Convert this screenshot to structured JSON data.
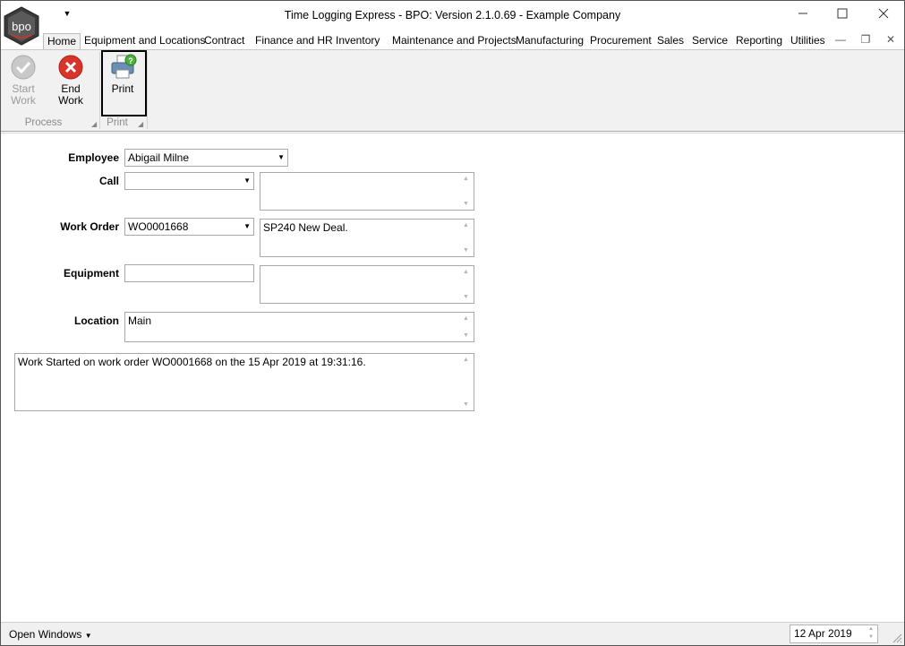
{
  "window": {
    "title": "Time Logging Express - BPO: Version 2.1.0.69 - Example Company",
    "logo_text": "bpo",
    "qat_icon": "chevron-down-icon",
    "minimize_icon": "minimize-icon",
    "maximize_icon": "maximize-icon",
    "close_icon": "close-icon"
  },
  "tabs": [
    {
      "label": "Home",
      "active": true
    },
    {
      "label": "Equipment and Locations"
    },
    {
      "label": "Contract"
    },
    {
      "label": "Finance and HR"
    },
    {
      "label": "Inventory"
    },
    {
      "label": "Maintenance and Projects"
    },
    {
      "label": "Manufacturing"
    },
    {
      "label": "Procurement"
    },
    {
      "label": "Sales"
    },
    {
      "label": "Service"
    },
    {
      "label": "Reporting"
    },
    {
      "label": "Utilities"
    }
  ],
  "ribbon": {
    "start_work": {
      "label_line1": "Start",
      "label_line2": "Work",
      "icon": "checkmark-icon",
      "enabled": false
    },
    "end_work": {
      "label": "End Work",
      "icon": "stop-x-icon"
    },
    "print": {
      "label": "Print",
      "icon": "printer-icon"
    },
    "group_process": "Process",
    "group_print": "Print"
  },
  "form": {
    "employee": {
      "label": "Employee",
      "value": "Abigail Milne"
    },
    "call": {
      "label": "Call",
      "value": "",
      "description": ""
    },
    "work_order": {
      "label": "Work Order",
      "value": "WO0001668",
      "description": "SP240 New Deal."
    },
    "equipment": {
      "label": "Equipment",
      "value": "",
      "description": ""
    },
    "location": {
      "label": "Location",
      "value": "Main"
    },
    "log_message": "Work Started on work order WO0001668 on the 15 Apr 2019 at 19:31:16."
  },
  "statusbar": {
    "open_windows": "Open Windows",
    "date": "12 Apr 2019"
  },
  "colors": {
    "ribbon_bg": "#f1f1f1",
    "end_work_red": "#d9342b",
    "start_work_gray": "#b9b9b9"
  }
}
